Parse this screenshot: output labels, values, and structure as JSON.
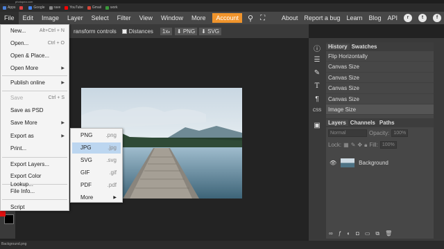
{
  "browser": {
    "tab_title": "photopea.com",
    "bookmarks": [
      {
        "label": "Apps",
        "color": "#4a7fd6"
      },
      {
        "label": "",
        "color": "#e04040"
      },
      {
        "label": "Google",
        "color": "#4285f4"
      },
      {
        "label": "rave",
        "color": "#888888"
      },
      {
        "label": "YouTube",
        "color": "#ff0000"
      },
      {
        "label": "Gmail",
        "color": "#d44638"
      },
      {
        "label": "work",
        "color": "#3a9a3a"
      }
    ]
  },
  "menubar": {
    "items": [
      "File",
      "Edit",
      "Image",
      "Layer",
      "Select",
      "Filter",
      "View",
      "Window",
      "More"
    ],
    "account": "Account",
    "right_links": [
      "About",
      "Report a bug",
      "Learn",
      "Blog",
      "API"
    ],
    "accent": "#f0942c"
  },
  "toolbar": {
    "transform_label": "ransform controls",
    "distances_label": "Distances",
    "zoom": "1x",
    "png_label": "PNG",
    "svg_label": "SVG"
  },
  "file_menu": {
    "items": [
      {
        "label": "New...",
        "shortcut": "Alt+Ctrl + N"
      },
      {
        "label": "Open...",
        "shortcut": "Ctrl + O"
      },
      {
        "label": "Open & Place...",
        "shortcut": ""
      },
      {
        "label": "Open More",
        "submenu": true
      },
      {
        "label": "Publish online",
        "submenu": true
      },
      {
        "label": "Save",
        "shortcut": "Ctrl + S",
        "disabled": true
      },
      {
        "label": "Save as PSD",
        "shortcut": ""
      },
      {
        "label": "Save More",
        "submenu": true
      },
      {
        "label": "Export as",
        "submenu": true
      },
      {
        "label": "Print...",
        "shortcut": ""
      },
      {
        "label": "Export Layers...",
        "shortcut": ""
      },
      {
        "label": "Export Color Lookup...",
        "shortcut": ""
      },
      {
        "label": "File Info...",
        "shortcut": ""
      },
      {
        "label": "Script",
        "shortcut": ""
      }
    ]
  },
  "export_menu": {
    "items": [
      {
        "label": "PNG",
        "ext": ".png"
      },
      {
        "label": "JPG",
        "ext": ".jpg",
        "highlighted": true
      },
      {
        "label": "SVG",
        "ext": ".svg"
      },
      {
        "label": "GIF",
        "ext": ".gif"
      },
      {
        "label": "PDF",
        "ext": ".pdf"
      },
      {
        "label": "More",
        "submenu": true
      }
    ]
  },
  "history_panel": {
    "tabs": [
      "History",
      "Swatches"
    ],
    "items": [
      "Flip Horizontally",
      "Canvas Size",
      "Canvas Size",
      "Canvas Size",
      "Canvas Size",
      "Image Size"
    ]
  },
  "layers_panel": {
    "tabs": [
      "Layers",
      "Channels",
      "Paths"
    ],
    "blend_mode": "Normal",
    "opacity_label": "Opacity:",
    "opacity_value": "100%",
    "lock_label": "Lock:",
    "fill_label": "Fill:",
    "fill_value": "100%",
    "layers": [
      {
        "name": "Background"
      }
    ]
  },
  "side_icons": [
    "info-icon",
    "sliders-icon",
    "brush-icon",
    "type-icon",
    "paragraph-icon",
    "css-icon",
    "image-icon"
  ],
  "side_icon_text": {
    "css": "CSS"
  },
  "status": {
    "file_chip": "Background.png"
  },
  "colors": {
    "foreground": "#e01010",
    "background": "#000000"
  }
}
